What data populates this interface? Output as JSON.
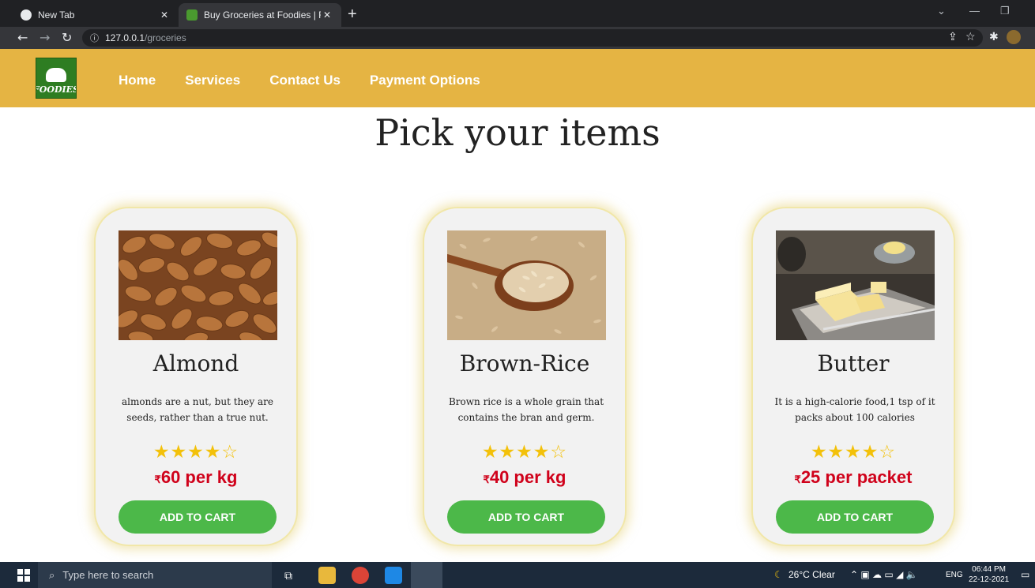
{
  "browser": {
    "tabs": [
      {
        "title": "New Tab",
        "active": false
      },
      {
        "title": "Buy Groceries at Foodies | Fresh ",
        "active": true
      }
    ],
    "url_host": "127.0.0.1",
    "url_path": "/groceries"
  },
  "site": {
    "logo_text": "FOODIES",
    "nav": [
      "Home",
      "Services",
      "Contact Us",
      "Payment Options"
    ],
    "page_title": "Pick your items",
    "accent_color": "#e5b443",
    "button_color": "#4cb849",
    "price_color": "#d0021b"
  },
  "products": [
    {
      "name": "Almond",
      "description": "almonds are a nut, but they are seeds, rather than a true nut.",
      "rating": 4.5,
      "currency": "₹",
      "price": "60 per kg",
      "button": "ADD TO CART",
      "image": "almonds-photo"
    },
    {
      "name": "Brown-Rice",
      "description": "Brown rice is a whole grain that contains the bran and germ.",
      "rating": 4.5,
      "currency": "₹",
      "price": "40 per kg",
      "button": "ADD TO CART",
      "image": "brown-rice-photo"
    },
    {
      "name": "Butter",
      "description": "It is a high-calorie food,1 tsp of it packs about 100 calories",
      "rating": 4.5,
      "currency": "₹",
      "price": "25 per packet",
      "button": "ADD TO CART",
      "image": "butter-photo"
    }
  ],
  "taskbar": {
    "search_placeholder": "Type here to search",
    "weather": "26°C  Clear",
    "language": "ENG",
    "time": "06:44 PM",
    "date": "22-12-2021"
  }
}
